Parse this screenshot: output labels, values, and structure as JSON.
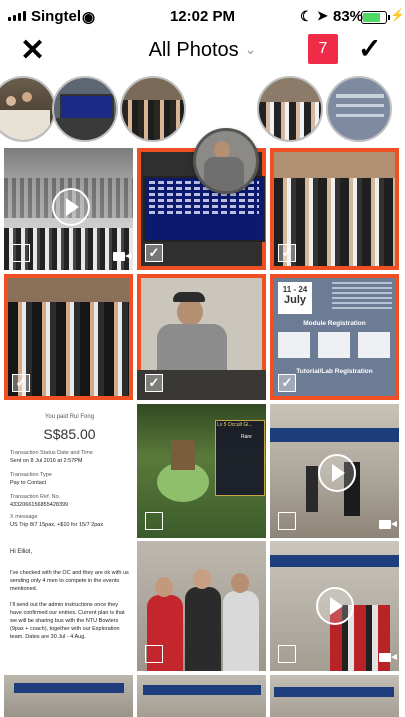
{
  "status_bar": {
    "carrier": "Singtel",
    "time": "12:02 PM",
    "battery_percent": "83%",
    "battery_level": 0.83,
    "icons": [
      "signal-icon",
      "wifi-icon",
      "moon-icon",
      "location-icon",
      "battery-icon",
      "charging-icon"
    ]
  },
  "nav": {
    "title": "All Photos",
    "selected_count": "7",
    "close_icon": "close-icon",
    "done_icon": "checkmark-icon",
    "accent_color": "#ef2b48"
  },
  "selection_color": "#f04e23",
  "selected_strip": {
    "thumbnails": [
      "group-photo",
      "bowling-scoreboard",
      "group-photo-indoor",
      "group-photo-graduation",
      "registration-slide"
    ]
  },
  "grid": {
    "tiles": [
      {
        "kind": "video",
        "selected": false,
        "desc": "stage-event"
      },
      {
        "kind": "photo",
        "selected": true,
        "desc": "bowling-scoreboard"
      },
      {
        "kind": "photo",
        "selected": true,
        "desc": "group-photo"
      },
      {
        "kind": "photo",
        "selected": true,
        "desc": "group-photo-graduation"
      },
      {
        "kind": "photo",
        "selected": true,
        "desc": "man-at-table"
      },
      {
        "kind": "photo",
        "selected": true,
        "desc": "registration-slide"
      },
      {
        "kind": "screenshot",
        "selected": false,
        "desc": "payment-receipt"
      },
      {
        "kind": "screenshot",
        "selected": false,
        "desc": "game-screenshot"
      },
      {
        "kind": "video",
        "selected": false,
        "desc": "bowling-alley"
      },
      {
        "kind": "screenshot",
        "selected": false,
        "desc": "email"
      },
      {
        "kind": "photo",
        "selected": false,
        "desc": "three-friends"
      },
      {
        "kind": "video",
        "selected": false,
        "desc": "bowling-group"
      }
    ]
  },
  "slide": {
    "date_day": "11 - 24",
    "date_month": "July",
    "heading1": "Module Registration",
    "heading2": "Tutorial/Lab Registration"
  },
  "receipt": {
    "header": "You paid Rui Fong",
    "amount": "S$85.00",
    "line1": "Transaction Status Date and Time",
    "line2": "Sent on 8 Jul 2016 at 2:57PM",
    "line3": "Transaction Type",
    "line4": "Pay to Contact",
    "line5": "Transaction Ref. No.",
    "line6": "4332066156855428399",
    "line7": "X message",
    "line8": "US Trip 8/7 15pax, +$10 for 15/7 2pax"
  },
  "email": {
    "greeting": "Hi Elliot,",
    "p1": "I've checked with the OC and they are ok with us sending only 4 men to compete in the events mentioned.",
    "p2": "I'll send out the admin instructions once they have confirmed our entries. Current plan is that we will be sharing bus with the NTU Bowlers (9pax + coach), together with our Exploration team. Dates are 30 Jul - 4 Aug."
  },
  "game": {
    "label1": "Lv 5 Occult Gi...",
    "stat1": "Rare"
  }
}
